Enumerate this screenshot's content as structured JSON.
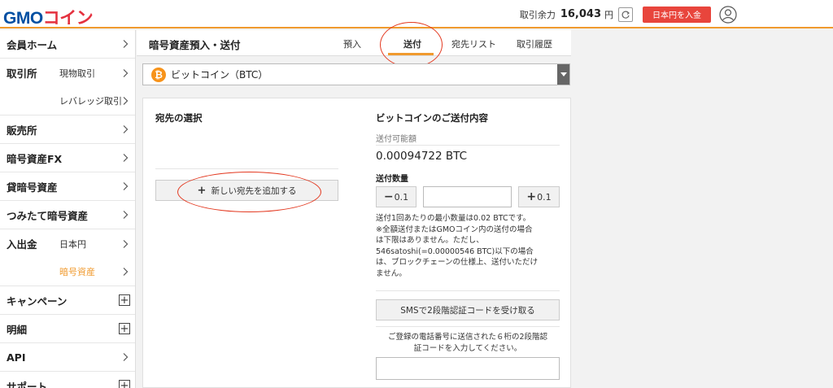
{
  "header": {
    "logo_main": "GMO",
    "logo_sub": "コイン",
    "balance_label": "取引余力",
    "balance_value": "16,043",
    "balance_unit": "円",
    "deposit_label": "日本円を入金"
  },
  "sidebar": {
    "items": [
      {
        "label": "会員ホーム"
      },
      {
        "label": "取引所",
        "sub": "現物取引"
      },
      {
        "label": "",
        "sub": "レバレッジ取引"
      },
      {
        "label": "販売所"
      },
      {
        "label": "暗号資産FX"
      },
      {
        "label": "貸暗号資産"
      },
      {
        "label": "つみたて暗号資産"
      },
      {
        "label": "入出金",
        "sub": "日本円"
      },
      {
        "label": "",
        "sub": "暗号資産"
      },
      {
        "label": "キャンペーン"
      },
      {
        "label": "明細"
      },
      {
        "label": "API"
      },
      {
        "label": "サポート"
      }
    ]
  },
  "content": {
    "page_title": "暗号資産預入・送付",
    "tabs": [
      {
        "label": "預入"
      },
      {
        "label": "送付"
      },
      {
        "label": "宛先リスト"
      },
      {
        "label": "取引履歴"
      }
    ]
  },
  "select": {
    "coin_symbol": "₿",
    "value": "ビットコイン（BTC）"
  },
  "panel": {
    "dest_title": "宛先の選択",
    "add_dest_label": "新しい宛先を追加する",
    "send_title": "ビットコインのご送付内容",
    "available_label": "送付可能額",
    "available_value": "0.00094722 BTC",
    "qty_label": "送付数量",
    "minus_label": "0.1",
    "plus_label": "0.1",
    "note_lines": [
      "送付1回あたりの最小数量は0.02 BTCです。",
      "※全額送付またはGMOコイン内の送付の場合",
      "は下限はありません。ただし、",
      "546satoshi(=0.00000546 BTC)以下の場合",
      "は、ブロックチェーンの仕様上、送付いただけ",
      "ません。"
    ],
    "sms_button": "SMSで2段階認証コードを受け取る",
    "sms_note_lines": [
      "ご登録の電話番号に送信された６桁の2段階認",
      "証コードを入力してください。"
    ]
  },
  "colors": {
    "accent": "#f09a2e",
    "deposit": "#e8453c",
    "annotation": "#e3381f",
    "btc": "#f7931a"
  }
}
